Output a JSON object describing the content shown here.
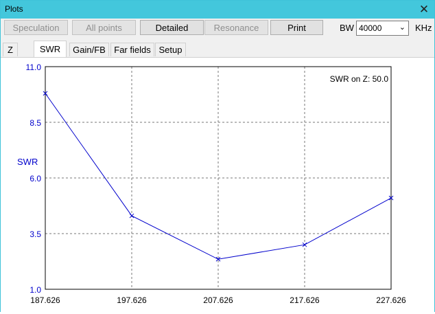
{
  "window": {
    "title": "Plots"
  },
  "toolbar": {
    "buttons": [
      {
        "label": "Speculation",
        "enabled": false
      },
      {
        "label": "All points",
        "enabled": false
      },
      {
        "label": "Detailed",
        "enabled": true
      },
      {
        "label": "Resonance",
        "enabled": false
      },
      {
        "label": "Print",
        "enabled": true
      }
    ],
    "bw_label": "BW",
    "bw_value": "40000",
    "unit_label": "KHz"
  },
  "tabs": [
    {
      "label": "Z",
      "active": false
    },
    {
      "label": "SWR",
      "active": true
    },
    {
      "label": "Gain/FB",
      "active": false
    },
    {
      "label": "Far fields",
      "active": false
    },
    {
      "label": "Setup",
      "active": false
    }
  ],
  "colors": {
    "titlebar": "#43c7dc",
    "series": "#0000cc",
    "axis_text": "#0000cc"
  },
  "chart_data": {
    "type": "line",
    "ylabel": "SWR",
    "annotation": "SWR on Z: 50.0",
    "x_tick_labels": [
      "187.626",
      "197.626",
      "207.626",
      "217.626",
      "227.626"
    ],
    "y_tick_labels": [
      "11.0",
      "8.5",
      "6.0",
      "3.5",
      "1.0"
    ],
    "x": [
      187.626,
      197.626,
      207.626,
      217.626,
      227.626
    ],
    "values": [
      9.8,
      4.3,
      2.35,
      3.0,
      5.1
    ],
    "xlim": [
      187.626,
      227.626
    ],
    "ylim": [
      1.0,
      11.0
    ],
    "grid": true
  }
}
